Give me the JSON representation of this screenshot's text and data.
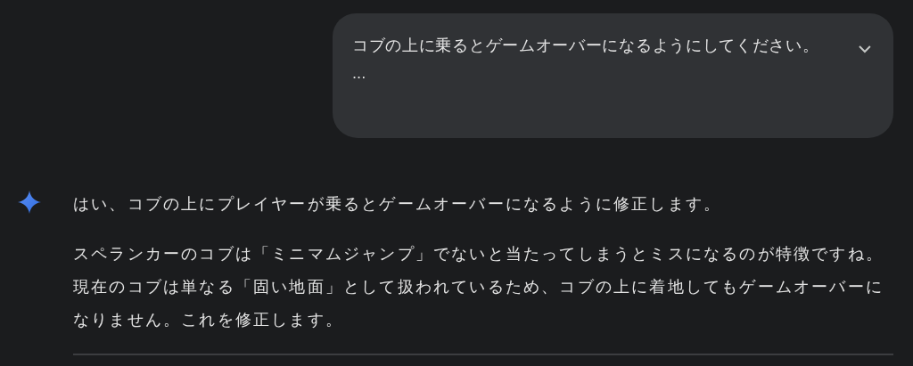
{
  "user_message": {
    "text": "コブの上に乗るとゲームオーバーになるようにしてください。",
    "more": "...",
    "expanded": false
  },
  "response": {
    "paragraphs": [
      "はい、コブの上にプレイヤーが乗るとゲームオーバーになるように修正します。",
      "スペランカーのコブは「ミニマムジャンプ」でないと当たってしまうとミスになるのが特徴ですね。現在のコブは単なる「固い地面」として扱われているため、コブの上に着地してもゲームオーバーになりません。これを修正します。"
    ]
  }
}
